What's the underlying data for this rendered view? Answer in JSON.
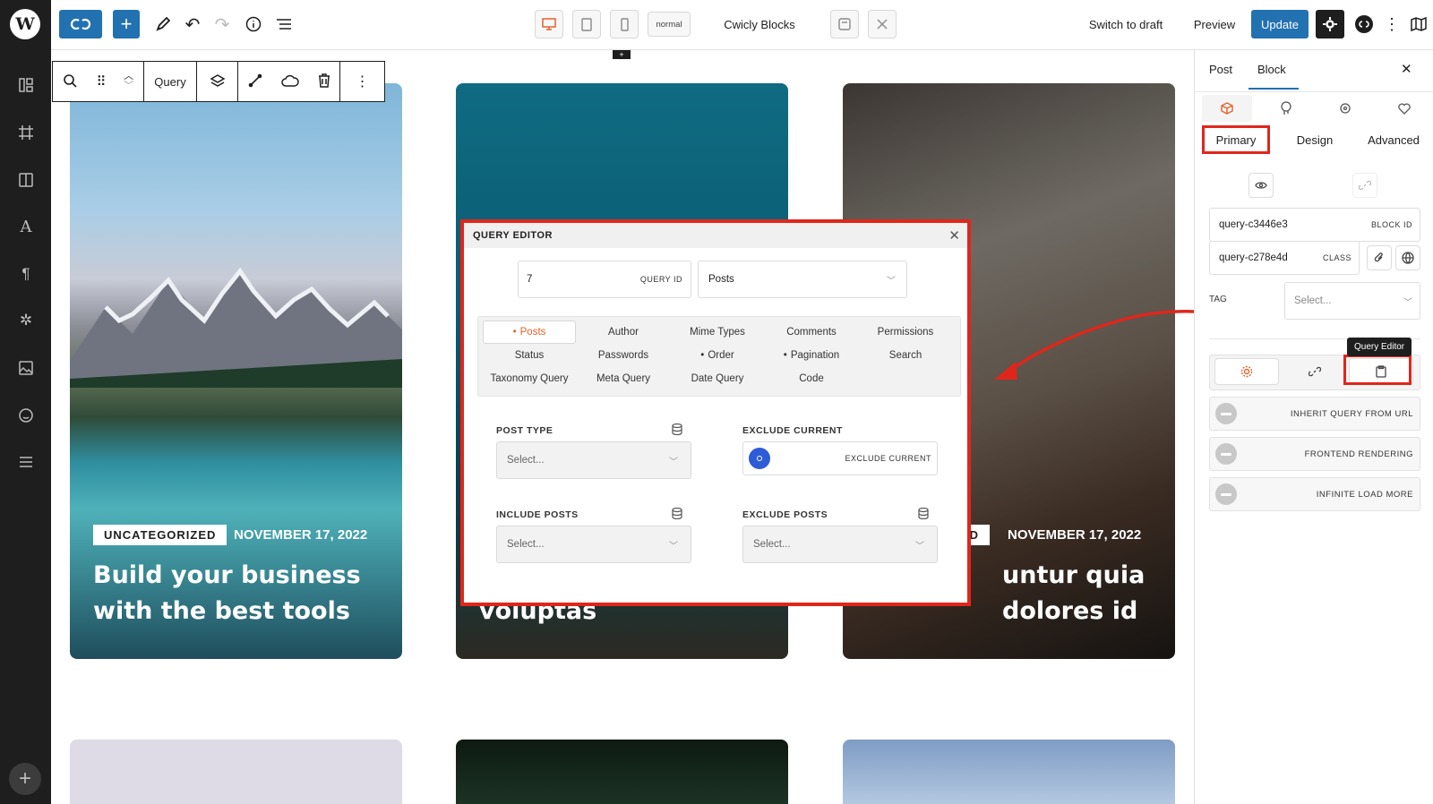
{
  "topbar": {
    "device_mode": "normal",
    "plugin_name": "Cwicly Blocks",
    "switch_draft": "Switch to draft",
    "preview": "Preview",
    "update": "Update"
  },
  "block_toolbar": {
    "query_label": "Query"
  },
  "cards": [
    {
      "category": "UNCATEGORIZED",
      "date": "NOVEMBER 17, 2022",
      "title": "Build your business with the best tools"
    },
    {
      "title": "voluptas"
    },
    {
      "category_partial": "ED",
      "date": "NOVEMBER 17, 2022",
      "title": "untur quia dolores id"
    }
  ],
  "query_editor": {
    "title": "QUERY EDITOR",
    "query_id_value": "7",
    "query_id_label": "QUERY ID",
    "post_source": "Posts",
    "tabs": [
      {
        "label": "Posts",
        "dot": true,
        "active": true
      },
      {
        "label": "Author",
        "dot": false
      },
      {
        "label": "Mime Types",
        "dot": false
      },
      {
        "label": "Comments",
        "dot": false
      },
      {
        "label": "Permissions",
        "dot": false
      },
      {
        "label": "Status",
        "dot": false
      },
      {
        "label": "Passwords",
        "dot": false
      },
      {
        "label": "Order",
        "dot": true
      },
      {
        "label": "Pagination",
        "dot": true
      },
      {
        "label": "Search",
        "dot": false
      },
      {
        "label": "Taxonomy Query",
        "dot": false
      },
      {
        "label": "Meta Query",
        "dot": false
      },
      {
        "label": "Date Query",
        "dot": false
      },
      {
        "label": "Code",
        "dot": false
      }
    ],
    "post_type_label": "POST TYPE",
    "post_type_placeholder": "Select...",
    "exclude_current_label": "EXCLUDE CURRENT",
    "exclude_current_toggle": "EXCLUDE CURRENT",
    "include_posts_label": "INCLUDE POSTS",
    "include_posts_placeholder": "Select...",
    "exclude_posts_label": "EXCLUDE POSTS",
    "exclude_posts_placeholder": "Select..."
  },
  "sidebar": {
    "tab_post": "Post",
    "tab_block": "Block",
    "subtab_primary": "Primary",
    "subtab_design": "Design",
    "subtab_advanced": "Advanced",
    "block_id_value": "query-c3446e3",
    "block_id_label": "BLOCK ID",
    "class_value": "query-c278e4d",
    "class_label": "CLASS",
    "tag_label": "TAG",
    "tag_placeholder": "Select...",
    "tooltip": "Query Editor",
    "toggles": [
      "INHERIT QUERY FROM URL",
      "FRONTEND RENDERING",
      "INFINITE LOAD MORE"
    ]
  },
  "colors": {
    "accent_blue": "#2271b1",
    "highlight_red": "#e0261b",
    "dark": "#1e1e1e",
    "active_orange": "#e0632a"
  }
}
